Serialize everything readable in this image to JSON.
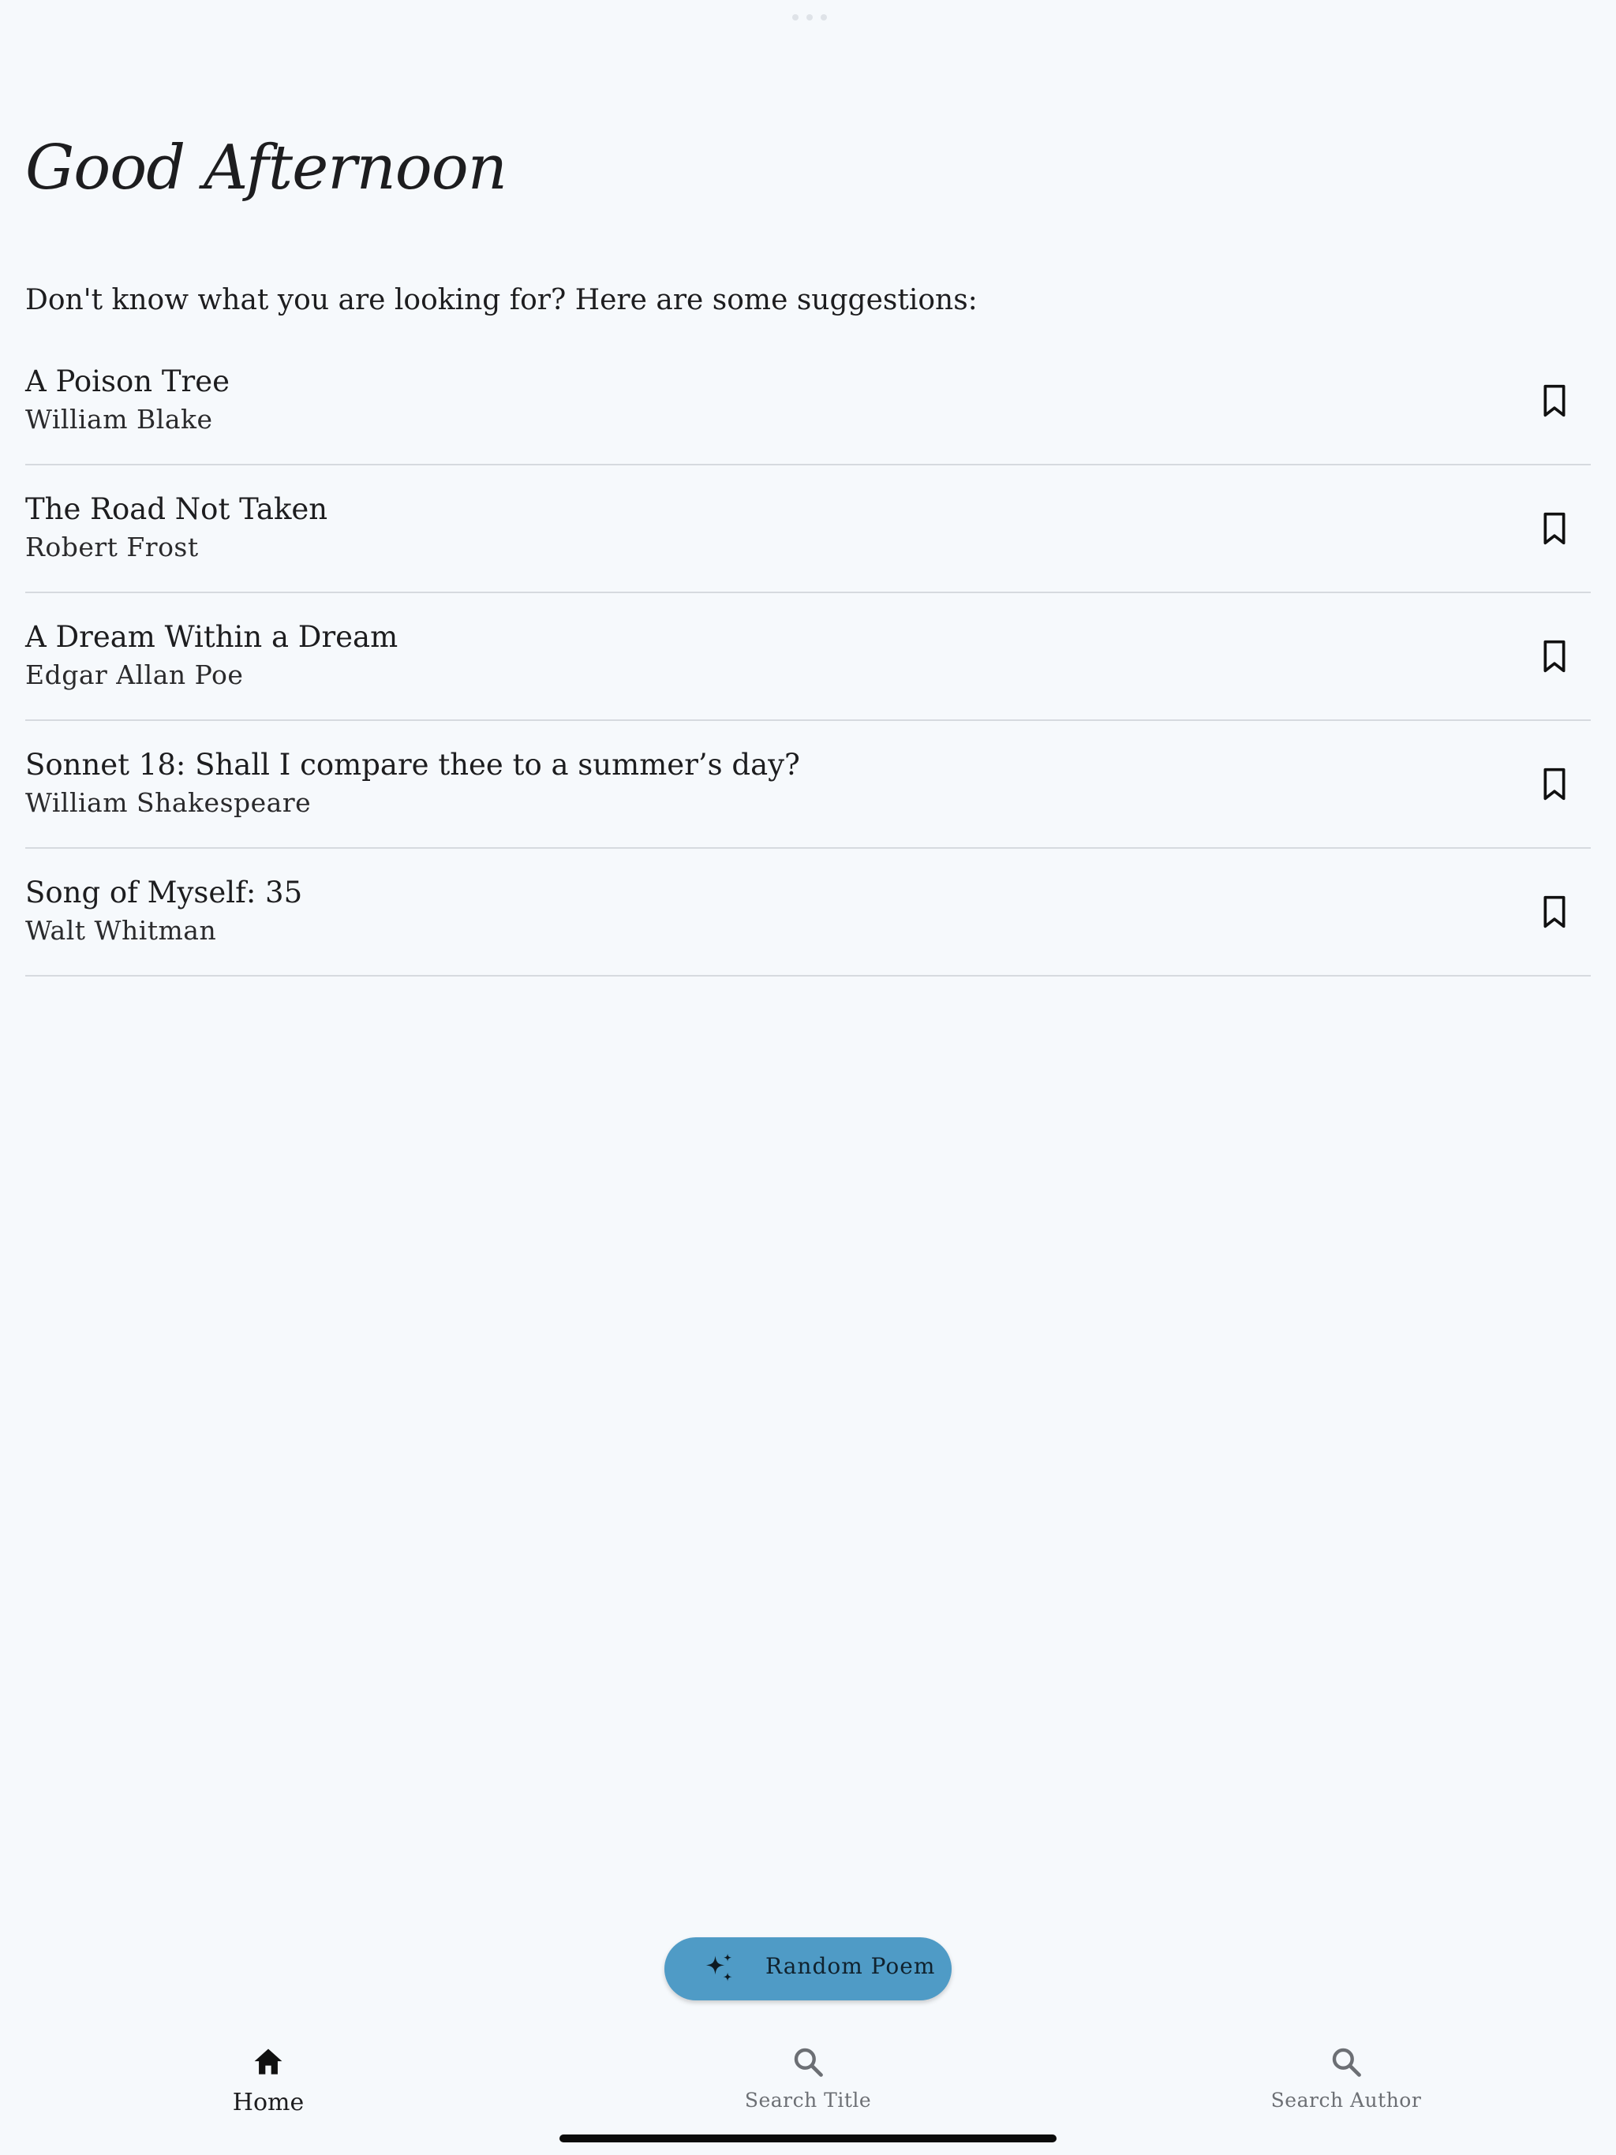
{
  "greeting": "Good Afternoon",
  "intro": "Don't know what you are looking for? Here are some suggestions:",
  "poems": [
    {
      "title": "A Poison Tree",
      "author": "William Blake"
    },
    {
      "title": "The Road Not Taken",
      "author": "Robert Frost"
    },
    {
      "title": "A Dream Within a Dream",
      "author": "Edgar Allan Poe"
    },
    {
      "title": "Sonnet 18: Shall I compare thee to a summer’s day?",
      "author": "William Shakespeare"
    },
    {
      "title": "Song of Myself: 35",
      "author": "Walt Whitman"
    }
  ],
  "fab": {
    "label": "Random Poem",
    "icon": "sparkle-icon"
  },
  "nav": {
    "items": [
      {
        "label": "Home",
        "icon": "home-icon",
        "active": true
      },
      {
        "label": "Search Title",
        "icon": "search-icon",
        "active": false
      },
      {
        "label": "Search Author",
        "icon": "search-icon",
        "active": false
      }
    ]
  },
  "colors": {
    "background": "#f6f9fc",
    "fab": "#4f9bc6",
    "divider": "#d6dadf",
    "text": "#1d1d1f",
    "inactive": "#6c6f74"
  }
}
